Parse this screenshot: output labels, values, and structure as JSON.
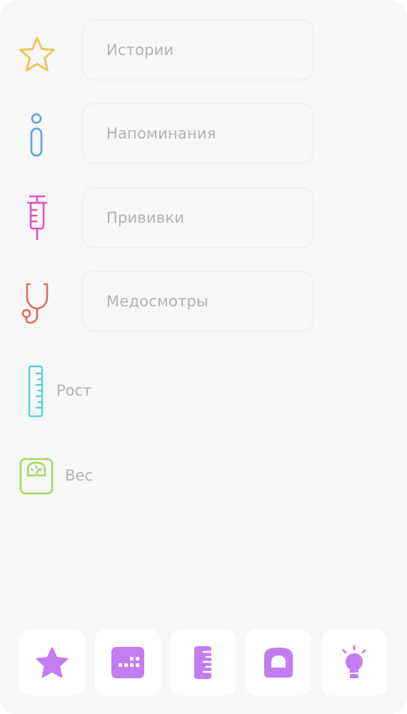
{
  "menu": {
    "stories": "Истории",
    "reminders": "Напоминания",
    "vaccinations": "Прививки",
    "checkups": "Медосмотры",
    "height": "Рост",
    "weight": "Вес"
  },
  "icons": {
    "stories": "star-outline-icon",
    "reminders": "info-icon",
    "vaccinations": "syringe-icon",
    "checkups": "stethoscope-icon",
    "height": "ruler-icon",
    "weight": "scale-icon"
  },
  "tabbar": {
    "icons": [
      "star-icon",
      "calendar-icon",
      "ruler-icon",
      "scale-icon",
      "lightbulb-icon"
    ],
    "accent": "#c47cf2"
  },
  "colors": {
    "star": "#f3c65c",
    "info": "#5aa2ea",
    "syringe": "#e052c2",
    "stethoscope": "#e46a62",
    "ruler": "#5ad4dc",
    "scale": "#a6d861",
    "label": "#b3b3b3",
    "background": "#f7f7f7"
  }
}
